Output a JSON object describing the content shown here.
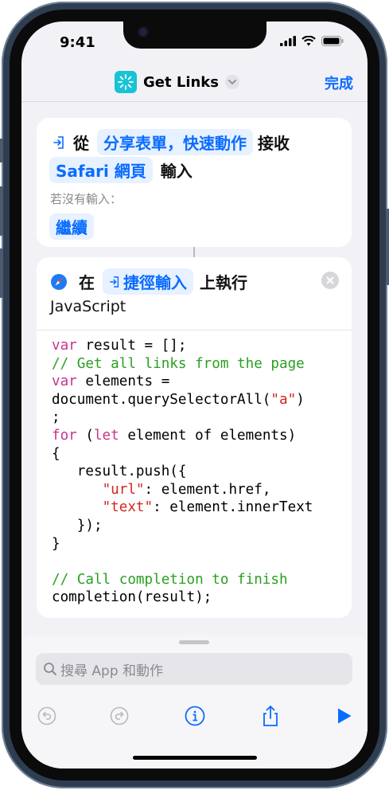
{
  "status_bar": {
    "time": "9:41"
  },
  "header": {
    "title": "Get Links",
    "done_label": "完成"
  },
  "card1": {
    "from_label": "從",
    "source_pill": "分享表單，快速動作",
    "receive_label": "接收",
    "type_pill": "Safari 網頁",
    "input_label": "輸入",
    "if_no_input_label": "若沒有輸入：",
    "continue_pill": "繼續"
  },
  "card2": {
    "at_label": "在",
    "shortcut_input_pill": "捷徑輸入",
    "run_label": "上執行",
    "action_name": "JavaScript"
  },
  "code": {
    "lines": [
      [
        {
          "t": "var",
          "c": "kw"
        },
        {
          "t": " result = [];"
        }
      ],
      [
        {
          "t": "// Get all links from the page",
          "c": "cm"
        }
      ],
      [
        {
          "t": "var",
          "c": "kw"
        },
        {
          "t": " elements ="
        }
      ],
      [
        {
          "t": "document.querySelectorAll("
        },
        {
          "t": "\"a\"",
          "c": "st"
        },
        {
          "t": ")"
        }
      ],
      [
        {
          "t": ";"
        }
      ],
      [
        {
          "t": "for",
          "c": "kw"
        },
        {
          "t": " ("
        },
        {
          "t": "let",
          "c": "kw"
        },
        {
          "t": " element of elements)"
        }
      ],
      [
        {
          "t": "{"
        }
      ],
      [
        {
          "t": "   result.push({"
        }
      ],
      [
        {
          "t": "      "
        },
        {
          "t": "\"url\"",
          "c": "st"
        },
        {
          "t": ": element.href,"
        }
      ],
      [
        {
          "t": "      "
        },
        {
          "t": "\"text\"",
          "c": "st"
        },
        {
          "t": ": element.innerText"
        }
      ],
      [
        {
          "t": "   });"
        }
      ],
      [
        {
          "t": "}"
        }
      ],
      [
        {
          "t": ""
        }
      ],
      [
        {
          "t": "// Call completion to finish",
          "c": "cm"
        }
      ],
      [
        {
          "t": "completion(result);"
        }
      ]
    ]
  },
  "search": {
    "placeholder": "搜尋 App 和動作"
  },
  "toolbar": {
    "icons": [
      "undo-icon",
      "redo-icon",
      "info-icon",
      "share-icon",
      "play-icon"
    ]
  },
  "colors": {
    "accent": "#0a6cff",
    "keyword": "#c8338c",
    "comment": "#2aa021",
    "string": "#d1251f",
    "app_icon": "#19c3d6"
  }
}
